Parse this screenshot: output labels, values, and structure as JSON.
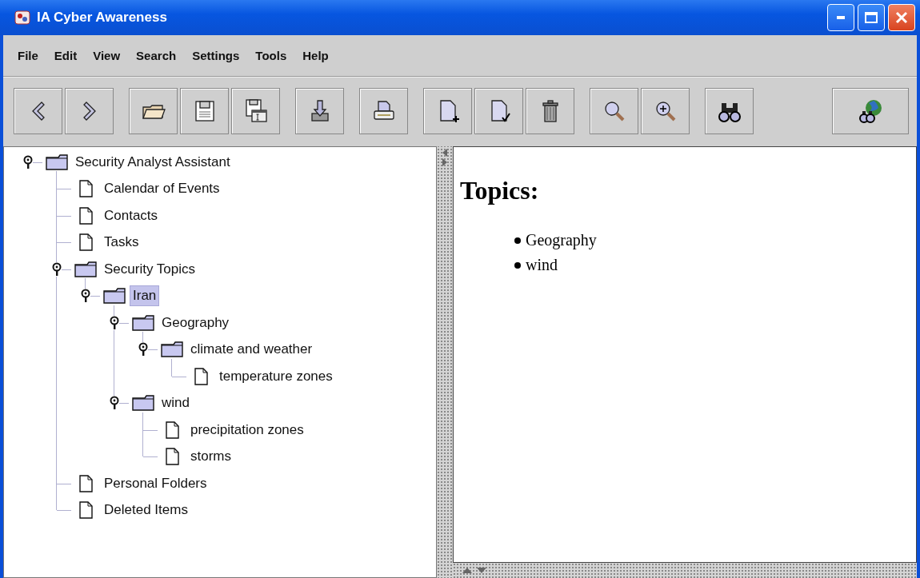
{
  "window": {
    "title": "IA Cyber Awareness"
  },
  "menu": [
    {
      "label": "File"
    },
    {
      "label": "Edit"
    },
    {
      "label": "View"
    },
    {
      "label": "Search"
    },
    {
      "label": "Settings"
    },
    {
      "label": "Tools"
    },
    {
      "label": "Help"
    }
  ],
  "toolbar": [
    {
      "buttons": [
        {
          "kind": "back"
        },
        {
          "kind": "forward"
        }
      ]
    },
    {
      "buttons": [
        {
          "kind": "open"
        },
        {
          "kind": "save"
        },
        {
          "kind": "save-as"
        }
      ]
    },
    {
      "buttons": [
        {
          "kind": "import"
        }
      ]
    },
    {
      "buttons": [
        {
          "kind": "print"
        }
      ]
    },
    {
      "buttons": [
        {
          "kind": "new-document"
        },
        {
          "kind": "check-document"
        },
        {
          "kind": "delete"
        }
      ]
    },
    {
      "buttons": [
        {
          "kind": "search"
        },
        {
          "kind": "zoom-in"
        }
      ]
    },
    {
      "buttons": [
        {
          "kind": "find"
        }
      ]
    },
    {
      "buttons": [
        {
          "kind": "web-search"
        }
      ]
    }
  ],
  "tree": [
    {
      "label": "Security Analyst Assistant",
      "kind": "folder",
      "expanded": true,
      "selected": false,
      "children": [
        {
          "label": "Calendar of Events",
          "kind": "document",
          "selected": false
        },
        {
          "label": "Contacts",
          "kind": "document",
          "selected": false
        },
        {
          "label": "Tasks",
          "kind": "document",
          "selected": false
        },
        {
          "label": "Security Topics",
          "kind": "folder",
          "expanded": true,
          "selected": false,
          "children": [
            {
              "label": "Iran",
              "kind": "folder",
              "expanded": true,
              "selected": true,
              "children": [
                {
                  "label": "Geography",
                  "kind": "folder",
                  "expanded": true,
                  "selected": false,
                  "children": [
                    {
                      "label": "climate and weather",
                      "kind": "folder",
                      "expanded": true,
                      "selected": false,
                      "children": [
                        {
                          "label": "temperature zones",
                          "kind": "document",
                          "selected": false
                        }
                      ]
                    }
                  ]
                },
                {
                  "label": "wind",
                  "kind": "folder",
                  "expanded": true,
                  "selected": false,
                  "children": [
                    {
                      "label": "precipitation zones",
                      "kind": "document",
                      "selected": false
                    },
                    {
                      "label": "storms",
                      "kind": "document",
                      "selected": false
                    }
                  ]
                }
              ]
            }
          ]
        },
        {
          "label": "Personal Folders",
          "kind": "document",
          "selected": false
        },
        {
          "label": "Deleted Items",
          "kind": "document",
          "selected": false
        }
      ]
    }
  ],
  "content": {
    "heading": "Topics:",
    "items": [
      "Geography",
      "wind"
    ]
  }
}
